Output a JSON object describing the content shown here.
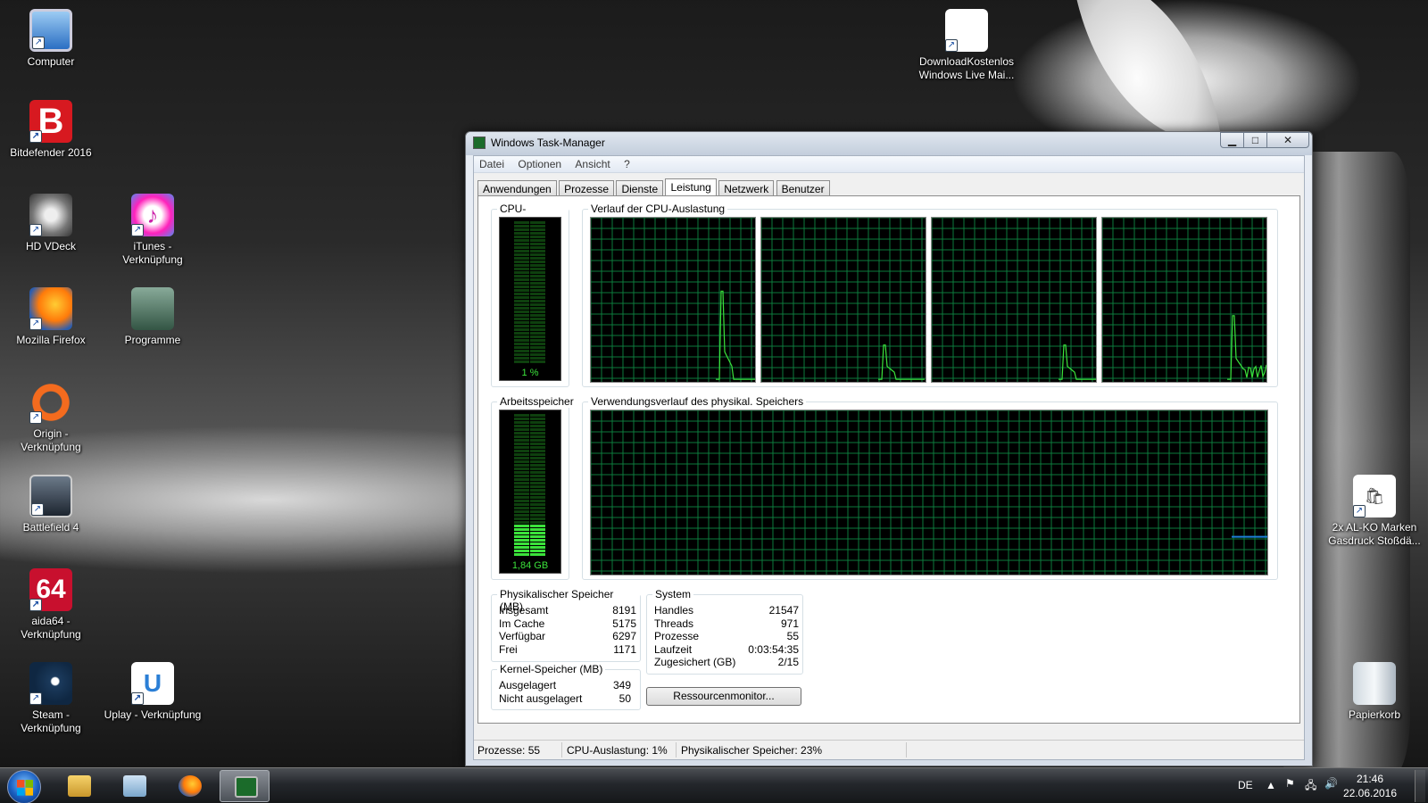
{
  "desktop": {
    "icons": [
      {
        "label": "Computer"
      },
      {
        "label": "Bitdefender 2016"
      },
      {
        "label": "HD VDeck"
      },
      {
        "label": "iTunes - Verknüpfung"
      },
      {
        "label": "Mozilla Firefox"
      },
      {
        "label": "Programme"
      },
      {
        "label": "Origin - Verknüpfung"
      },
      {
        "label": "Battlefield 4"
      },
      {
        "label": "aida64 - Verknüpfung"
      },
      {
        "label": "Steam - Verknüpfung"
      },
      {
        "label": "Uplay - Verknüpfung"
      },
      {
        "label": "DownloadKostenlos Windows Live Mai..."
      },
      {
        "label": "2x AL-KO Marken Gasdruck Stoßdä..."
      },
      {
        "label": "Papierkorb"
      }
    ],
    "bitdefender_glyph": "B",
    "aida_glyph": "64",
    "uplay_glyph": "U",
    "itunes_glyph": "♪"
  },
  "taskmanager": {
    "title": "Windows Task-Manager",
    "window_buttons": {
      "minimize": "▁",
      "maximize": "□",
      "close": "✕"
    },
    "menu": [
      "Datei",
      "Optionen",
      "Ansicht",
      "?"
    ],
    "tabs": [
      "Anwendungen",
      "Prozesse",
      "Dienste",
      "Leistung",
      "Netzwerk",
      "Benutzer"
    ],
    "active_tab": "Leistung",
    "cpu_usage": {
      "title": "CPU-Auslastung",
      "value": "1 %",
      "percent": 1
    },
    "cpu_history": {
      "title": "Verlauf der CPU-Auslastung"
    },
    "memory": {
      "title": "Arbeitsspeicher",
      "value": "1,84 GB",
      "fraction": 0.23
    },
    "memory_history": {
      "title": "Verwendungsverlauf des physikal. Speichers"
    },
    "physical_memory": {
      "title": "Physikalischer Speicher (MB)",
      "rows": [
        {
          "label": "Insgesamt",
          "value": "8191"
        },
        {
          "label": "Im Cache",
          "value": "5175"
        },
        {
          "label": "Verfügbar",
          "value": "6297"
        },
        {
          "label": "Frei",
          "value": "1171"
        }
      ]
    },
    "kernel_memory": {
      "title": "Kernel-Speicher (MB)",
      "rows": [
        {
          "label": "Ausgelagert",
          "value": "349"
        },
        {
          "label": "Nicht ausgelagert",
          "value": "50"
        }
      ]
    },
    "system": {
      "title": "System",
      "rows": [
        {
          "label": "Handles",
          "value": "21547"
        },
        {
          "label": "Threads",
          "value": "971"
        },
        {
          "label": "Prozesse",
          "value": "55"
        },
        {
          "label": "Laufzeit",
          "value": "0:03:54:35"
        },
        {
          "label": "Zugesichert (GB)",
          "value": "2/15"
        }
      ]
    },
    "resource_monitor_button": "Ressourcenmonitor...",
    "statusbar": {
      "processes": "Prozesse: 55",
      "cpu": "CPU-Auslastung: 1%",
      "memory": "Physikalischer Speicher: 23%"
    }
  },
  "taskbar": {
    "language": "DE",
    "time": "21:46",
    "date": "22.06.2016",
    "tray_icons": [
      "show-hidden-icons",
      "action-center-flag",
      "network",
      "volume"
    ]
  },
  "colors": {
    "graph_grid": "#0d7a3d",
    "graph_line": "#3be23b",
    "memory_line": "#1e7fd8",
    "meter_bar": "#1f8f1f"
  }
}
